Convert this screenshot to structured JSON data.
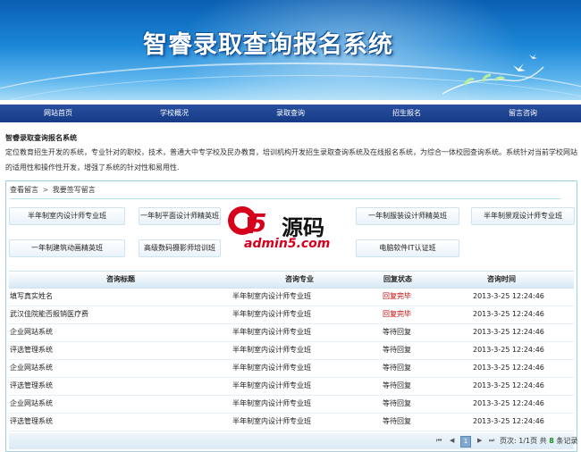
{
  "banner": {
    "title": "智睿录取查询报名系统"
  },
  "nav": {
    "items": [
      {
        "label": "网站首页"
      },
      {
        "label": "学校概况"
      },
      {
        "label": "录取查询"
      },
      {
        "label": "招生报名"
      },
      {
        "label": "留言咨询"
      }
    ]
  },
  "intro": {
    "title": "智睿录取查询报名系统",
    "text": "定位教育招生开发的系统，专业针对的职校，技术，普通大中专学校及民办教育，培训机构开发招生录取查询系统及在线报名系统，为综合一体校园查询系统。系统针对当前学校网站的适用性和操作性开发，增强了系统的针对性和易用性."
  },
  "messages": {
    "breadcrumb_view": "查看留言",
    "breadcrumb_sep": ">",
    "breadcrumb_write": "我要签写留言",
    "courses": [
      "半年制室内设计师专业班",
      "一年制平面设计师精英班",
      "",
      "一年制服装设计师精英班",
      "半年制景观设计师专业班",
      "一年制建筑动画精英班",
      "高级数码摄影师培训班",
      "",
      "电脑软件IT认证班"
    ],
    "watermark": {
      "mark": "a5",
      "cn": "源码",
      "site": "admin5.com"
    },
    "table": {
      "headers": [
        "咨询标题",
        "咨询专业",
        "回复状态",
        "咨询时间"
      ],
      "rows": [
        {
          "title": "填写真实姓名",
          "course": "半年制室内设计师专业班",
          "status": "回复完毕",
          "time": "2013-3-25 12:24:46",
          "done": true
        },
        {
          "title": "武汉佳院能否报销医疗费",
          "course": "半年制室内设计师专业班",
          "status": "回复完毕",
          "time": "2013-3-25 12:24:46",
          "done": true
        },
        {
          "title": "企业网站系统",
          "course": "半年制室内设计师专业班",
          "status": "等待回复",
          "time": "2013-3-25 12:24:46",
          "done": false
        },
        {
          "title": "评选管理系统",
          "course": "半年制室内设计师专业班",
          "status": "等待回复",
          "time": "2013-3-25 12:24:46",
          "done": false
        },
        {
          "title": "企业网站系统",
          "course": "半年制室内设计师专业班",
          "status": "等待回复",
          "time": "2013-3-25 12:24:46",
          "done": false
        },
        {
          "title": "评选管理系统",
          "course": "半年制室内设计师专业班",
          "status": "等待回复",
          "time": "2013-3-25 12:24:46",
          "done": false
        },
        {
          "title": "企业网站系统",
          "course": "半年制室内设计师专业班",
          "status": "等待回复",
          "time": "2013-3-25 12:24:46",
          "done": false
        },
        {
          "title": "评选管理系统",
          "course": "半年制室内设计师专业班",
          "status": "等待回复",
          "time": "2013-3-25 12:24:46",
          "done": false
        }
      ]
    },
    "pager": {
      "current_page": "1",
      "page_info_prefix": "页次: 1/1页  共",
      "total": "8",
      "page_info_suffix": "条记录"
    }
  },
  "colors": {
    "nav_bg": "#163b86",
    "panel_border": "#9fd0ea",
    "status_done": "#c00000",
    "total_count": "#1a8a1a"
  }
}
